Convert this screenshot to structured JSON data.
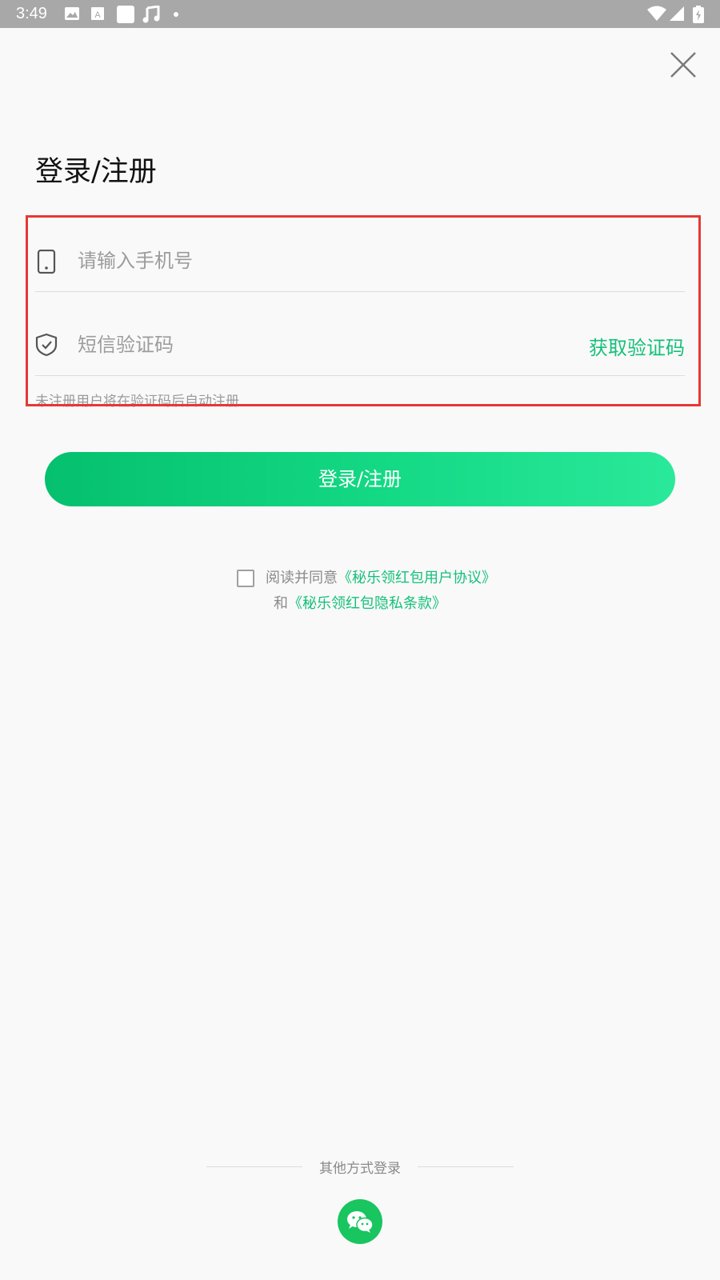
{
  "status_bar": {
    "time": "3:49"
  },
  "header": {
    "title": "登录/注册",
    "close_icon": "close-icon"
  },
  "form": {
    "phone_placeholder": "请输入手机号",
    "code_placeholder": "短信验证码",
    "get_code_label": "获取验证码",
    "hint": "未注册用户将在验证码后自动注册"
  },
  "login_button": {
    "label": "登录/注册"
  },
  "agreement": {
    "prefix": "阅读并同意",
    "user_agreement": "《秘乐领红包用户协议》",
    "conjunction": "和",
    "privacy_policy": "《秘乐领红包隐私条款》"
  },
  "other_login": {
    "label": "其他方式登录",
    "wechat_icon": "wechat-icon"
  },
  "colors": {
    "accent": "#16c07a",
    "highlight": "#e53935",
    "status_bar": "#a8a8a8",
    "wechat": "#18c55f"
  }
}
